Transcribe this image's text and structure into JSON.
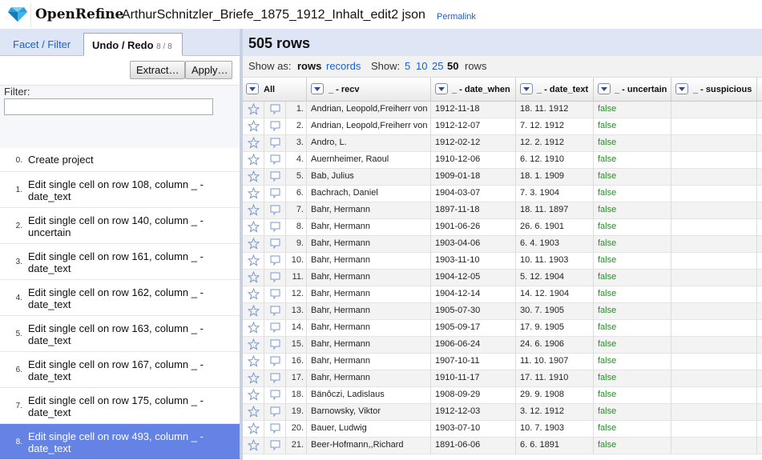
{
  "header": {
    "logo_text": "OpenRefine",
    "project_name": "ArthurSchnitzler_Briefe_1875_1912_Inhalt_edit2 json",
    "permalink": "Permalink"
  },
  "left_panel": {
    "tabs": {
      "facet_filter": "Facet / Filter",
      "undo_redo": "Undo / Redo",
      "undo_count": "8 / 8"
    },
    "buttons": {
      "extract": "Extract…",
      "apply": "Apply…"
    },
    "filter_label": "Filter:",
    "filter_value": "",
    "history": [
      {
        "num": "0.",
        "text": "Create project"
      },
      {
        "num": "1.",
        "text": "Edit single cell on row 108, column _ - date_text"
      },
      {
        "num": "2.",
        "text": "Edit single cell on row 140, column _ - uncertain"
      },
      {
        "num": "3.",
        "text": "Edit single cell on row 161, column _ - date_text"
      },
      {
        "num": "4.",
        "text": "Edit single cell on row 162, column _ - date_text"
      },
      {
        "num": "5.",
        "text": "Edit single cell on row 163, column _ - date_text"
      },
      {
        "num": "6.",
        "text": "Edit single cell on row 167, column _ - date_text"
      },
      {
        "num": "7.",
        "text": "Edit single cell on row 175, column _ - date_text"
      },
      {
        "num": "8.",
        "text": "Edit single cell on row 493, column _ - date_text"
      }
    ]
  },
  "summary": {
    "row_count": "505 rows"
  },
  "view_bar": {
    "show_as": "Show as:",
    "rows": "rows",
    "records": "records",
    "show": "Show:",
    "sizes": [
      "5",
      "10",
      "25",
      "50"
    ],
    "rows_suffix": "rows"
  },
  "columns": {
    "all": "All",
    "recv": "_ - recv",
    "date_when": "_ - date_when",
    "date_text": "_ - date_text",
    "uncertain": "_ - uncertain",
    "suspicious": "_ - suspicious"
  },
  "rows": [
    {
      "idx": "1.",
      "recv": "Andrian, Leopold,Freiherr von",
      "date_when": "1912-11-18",
      "date_text": "18. 11. 1912",
      "uncertain": "false",
      "suspicious": ""
    },
    {
      "idx": "2.",
      "recv": "Andrian, Leopold,Freiherr von",
      "date_when": "1912-12-07",
      "date_text": "7. 12. 1912",
      "uncertain": "false",
      "suspicious": ""
    },
    {
      "idx": "3.",
      "recv": "Andro, L.",
      "date_when": "1912-02-12",
      "date_text": "12. 2. 1912",
      "uncertain": "false",
      "suspicious": ""
    },
    {
      "idx": "4.",
      "recv": "Auernheimer, Raoul",
      "date_when": "1910-12-06",
      "date_text": "6. 12. 1910",
      "uncertain": "false",
      "suspicious": ""
    },
    {
      "idx": "5.",
      "recv": "Bab, Julius",
      "date_when": "1909-01-18",
      "date_text": "18. 1. 1909",
      "uncertain": "false",
      "suspicious": ""
    },
    {
      "idx": "6.",
      "recv": "Bachrach, Daniel",
      "date_when": "1904-03-07",
      "date_text": "7. 3. 1904",
      "uncertain": "false",
      "suspicious": ""
    },
    {
      "idx": "7.",
      "recv": "Bahr, Hermann",
      "date_when": "1897-11-18",
      "date_text": "18. 11. 1897",
      "uncertain": "false",
      "suspicious": ""
    },
    {
      "idx": "8.",
      "recv": "Bahr, Hermann",
      "date_when": "1901-06-26",
      "date_text": "26. 6. 1901",
      "uncertain": "false",
      "suspicious": ""
    },
    {
      "idx": "9.",
      "recv": "Bahr, Hermann",
      "date_when": "1903-04-06",
      "date_text": "6. 4. 1903",
      "uncertain": "false",
      "suspicious": ""
    },
    {
      "idx": "10.",
      "recv": "Bahr, Hermann",
      "date_when": "1903-11-10",
      "date_text": "10. 11. 1903",
      "uncertain": "false",
      "suspicious": ""
    },
    {
      "idx": "11.",
      "recv": "Bahr, Hermann",
      "date_when": "1904-12-05",
      "date_text": "5. 12. 1904",
      "uncertain": "false",
      "suspicious": ""
    },
    {
      "idx": "12.",
      "recv": "Bahr, Hermann",
      "date_when": "1904-12-14",
      "date_text": "14. 12. 1904",
      "uncertain": "false",
      "suspicious": ""
    },
    {
      "idx": "13.",
      "recv": "Bahr, Hermann",
      "date_when": "1905-07-30",
      "date_text": "30. 7. 1905",
      "uncertain": "false",
      "suspicious": ""
    },
    {
      "idx": "14.",
      "recv": "Bahr, Hermann",
      "date_when": "1905-09-17",
      "date_text": "17. 9. 1905",
      "uncertain": "false",
      "suspicious": ""
    },
    {
      "idx": "15.",
      "recv": "Bahr, Hermann",
      "date_when": "1906-06-24",
      "date_text": "24. 6. 1906",
      "uncertain": "false",
      "suspicious": ""
    },
    {
      "idx": "16.",
      "recv": "Bahr, Hermann",
      "date_when": "1907-10-11",
      "date_text": "11. 10. 1907",
      "uncertain": "false",
      "suspicious": ""
    },
    {
      "idx": "17.",
      "recv": "Bahr, Hermann",
      "date_when": "1910-11-17",
      "date_text": "17. 11. 1910",
      "uncertain": "false",
      "suspicious": ""
    },
    {
      "idx": "18.",
      "recv": "Bänôczi, Ladislaus",
      "date_when": "1908-09-29",
      "date_text": "29. 9. 1908",
      "uncertain": "false",
      "suspicious": ""
    },
    {
      "idx": "19.",
      "recv": "Barnowsky, Viktor",
      "date_when": "1912-12-03",
      "date_text": "3. 12. 1912",
      "uncertain": "false",
      "suspicious": ""
    },
    {
      "idx": "20.",
      "recv": "Bauer, Ludwig",
      "date_when": "1903-07-10",
      "date_text": "10. 7. 1903",
      "uncertain": "false",
      "suspicious": ""
    },
    {
      "idx": "21.",
      "recv": "Beer-Hofmann,,Richard",
      "date_when": "1891-06-06",
      "date_text": "6. 6. 1891",
      "uncertain": "false",
      "suspicious": ""
    }
  ]
}
